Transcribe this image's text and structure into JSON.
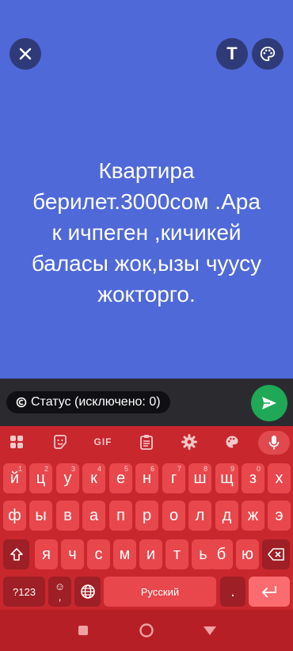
{
  "status_text": "Квартира\nберилет.3000сом .Ара\nк ичпеген ,кичикей\nбаласы жок,ызы чуусу\nжокторго.",
  "top_buttons": {
    "text_label": "T"
  },
  "privacy_pill": {
    "label": "Статус (исключено: 0)"
  },
  "keyboard": {
    "toolbar_gif": "GIF",
    "row1": [
      {
        "char": "й",
        "hint": "1"
      },
      {
        "char": "ц",
        "hint": "2"
      },
      {
        "char": "у",
        "hint": "3"
      },
      {
        "char": "к",
        "hint": "4"
      },
      {
        "char": "е",
        "hint": "5"
      },
      {
        "char": "н",
        "hint": "6"
      },
      {
        "char": "г",
        "hint": "7"
      },
      {
        "char": "ш",
        "hint": "8"
      },
      {
        "char": "щ",
        "hint": "9"
      },
      {
        "char": "з",
        "hint": "0"
      },
      {
        "char": "х",
        "hint": ""
      }
    ],
    "row2": [
      "ф",
      "ы",
      "в",
      "а",
      "п",
      "р",
      "о",
      "л",
      "д",
      "ж",
      "э"
    ],
    "row3": [
      "я",
      "ч",
      "с",
      "м",
      "и",
      "т",
      "ь",
      "б",
      "ю"
    ],
    "symbols_label": "?123",
    "emoji_top": "☺",
    "emoji_bottom": ",",
    "space_label": "Русский",
    "period_label": "."
  },
  "colors": {
    "canvas_bg": "#4f69d8",
    "keyboard_bg": "#c8272e",
    "key_bg": "#e8474c",
    "send_green": "#1fa855"
  }
}
